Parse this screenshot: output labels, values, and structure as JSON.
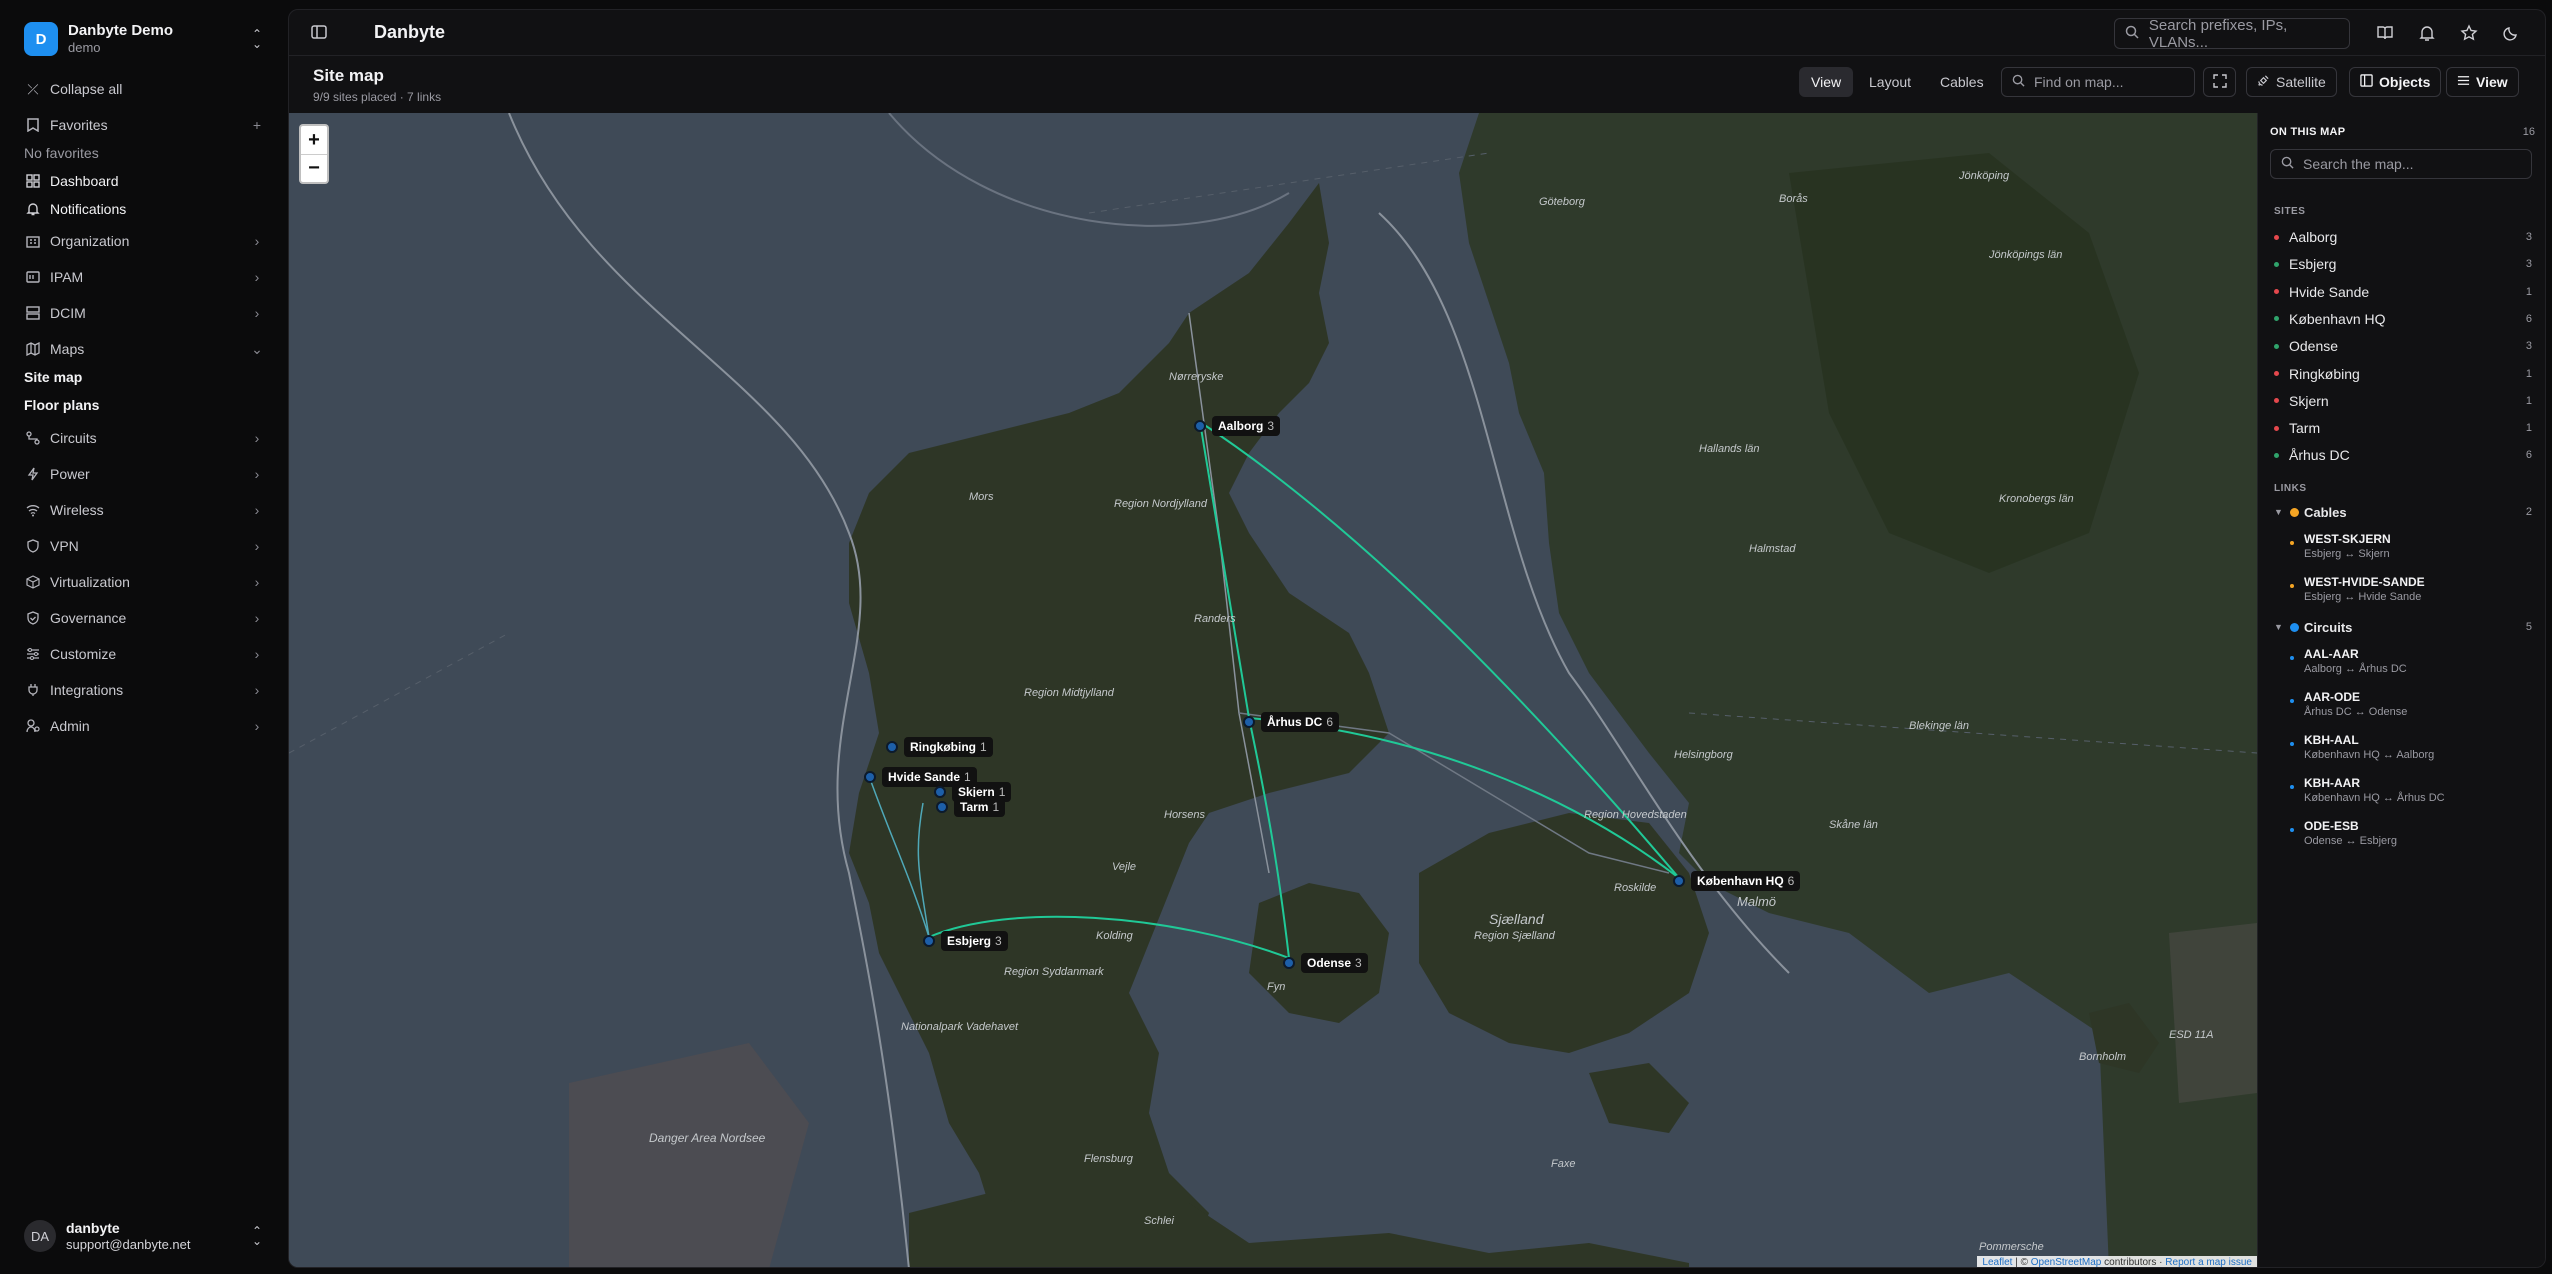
{
  "workspace": {
    "initial": "D",
    "name": "Danbyte Demo",
    "sub": "demo"
  },
  "sidebar": {
    "collapse_all": "Collapse all",
    "favorites": "Favorites",
    "no_favorites": "No favorites",
    "dashboard": "Dashboard",
    "notifications": "Notifications",
    "organization": "Organization",
    "ipam": "IPAM",
    "dcim": "DCIM",
    "maps": "Maps",
    "site_map": "Site map",
    "floor_plans": "Floor plans",
    "circuits": "Circuits",
    "power": "Power",
    "wireless": "Wireless",
    "vpn": "VPN",
    "virtualization": "Virtualization",
    "governance": "Governance",
    "customize": "Customize",
    "integrations": "Integrations",
    "admin": "Admin"
  },
  "user": {
    "initials": "DA",
    "name": "danbyte",
    "email": "support@danbyte.net"
  },
  "topbar": {
    "title": "Danbyte",
    "search_placeholder": "Search prefixes, IPs, VLANs..."
  },
  "header": {
    "title": "Site map",
    "subtitle": "9/9 sites placed · 7 links",
    "tabs": {
      "view": "View",
      "layout": "Layout",
      "cables": "Cables"
    },
    "find_placeholder": "Find on map...",
    "satellite": "Satellite",
    "objects": "Objects",
    "view_btn": "View"
  },
  "map": {
    "zoom_in": "+",
    "zoom_out": "−",
    "markers": [
      {
        "name": "Aalborg",
        "count": "3"
      },
      {
        "name": "Århus DC",
        "count": "6"
      },
      {
        "name": "Ringkøbing",
        "count": "1"
      },
      {
        "name": "Hvide Sande",
        "count": "1"
      },
      {
        "name": "Skjern",
        "count": "1"
      },
      {
        "name": "Tarm",
        "count": "1"
      },
      {
        "name": "Esbjerg",
        "count": "3"
      },
      {
        "name": "Odense",
        "count": "3"
      },
      {
        "name": "København HQ",
        "count": "6"
      }
    ],
    "labels": {
      "goteborg": "Göteborg",
      "boras": "Borås",
      "jonkoping": "Jönköping",
      "jonkopings_lan": "Jönköpings län",
      "hallands_lan": "Hallands län",
      "halmstad": "Halmstad",
      "kronobergs_lan": "Kronobergs län",
      "noerreryske": "Nørreryske",
      "mors": "Mors",
      "region_nordjylland": "Region Nordjylland",
      "randers": "Randers",
      "region_midtjylland": "Region Midtjylland",
      "horsens": "Horsens",
      "vejle": "Vejle",
      "kolding": "Kolding",
      "region_syddanmark": "Region Syddanmark",
      "nationalpark": "Nationalpark Vadehavet",
      "fyn": "Fyn",
      "sjaelland": "Sjælland",
      "region_sjaelland": "Region Sjælland",
      "region_hovedstaden": "Region Hovedstaden",
      "helsingborg": "Helsingborg",
      "malmo": "Malmö",
      "skane_lan": "Skåne län",
      "blekinge_lan": "Blekinge län",
      "bornholm": "Bornholm",
      "danger_area": "Danger Area Nordsee",
      "flensburg": "Flensburg",
      "schlei": "Schlei",
      "pommersche": "Pommersche",
      "roskilde": "Roskilde",
      "faxe": "Faxe",
      "esd": "ESD 11A"
    },
    "attribution": {
      "leaflet": "Leaflet",
      "osm": "OpenStreetMap",
      "contributors": "contributors",
      "report": "Report a map issue"
    }
  },
  "panel": {
    "title": "ON THIS MAP",
    "count": "16",
    "search_placeholder": "Search the map...",
    "sites_label": "SITES",
    "sites": [
      {
        "name": "Aalborg",
        "count": "3",
        "color": "#e5484d"
      },
      {
        "name": "Esbjerg",
        "count": "3",
        "color": "#30a46c"
      },
      {
        "name": "Hvide Sande",
        "count": "1",
        "color": "#e5484d"
      },
      {
        "name": "København HQ",
        "count": "6",
        "color": "#30a46c"
      },
      {
        "name": "Odense",
        "count": "3",
        "color": "#30a46c"
      },
      {
        "name": "Ringkøbing",
        "count": "1",
        "color": "#e5484d"
      },
      {
        "name": "Skjern",
        "count": "1",
        "color": "#e5484d"
      },
      {
        "name": "Tarm",
        "count": "1",
        "color": "#e5484d"
      },
      {
        "name": "Århus DC",
        "count": "6",
        "color": "#30a46c"
      }
    ],
    "links_label": "LINKS",
    "cables": {
      "name": "Cables",
      "count": "2",
      "color": "#f5a524"
    },
    "cable_items": [
      {
        "name": "WEST-SKJERN",
        "sub": "Esbjerg ↔ Skjern"
      },
      {
        "name": "WEST-HVIDE-SANDE",
        "sub": "Esbjerg ↔ Hvide Sande"
      }
    ],
    "circuits": {
      "name": "Circuits",
      "count": "5",
      "color": "#1e8ff0"
    },
    "circuit_items": [
      {
        "name": "AAL-AAR",
        "sub": "Aalborg ↔ Århus DC"
      },
      {
        "name": "AAR-ODE",
        "sub": "Århus DC ↔ Odense"
      },
      {
        "name": "KBH-AAL",
        "sub": "København HQ ↔ Aalborg"
      },
      {
        "name": "KBH-AAR",
        "sub": "København HQ ↔ Århus DC"
      },
      {
        "name": "ODE-ESB",
        "sub": "Odense ↔ Esbjerg"
      }
    ]
  }
}
